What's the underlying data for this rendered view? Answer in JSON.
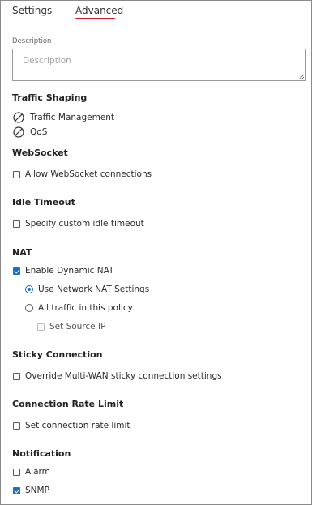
{
  "tabs": [
    {
      "label": "Settings"
    },
    {
      "label": "Advanced"
    }
  ],
  "description": {
    "label": "Description",
    "placeholder": "Description",
    "value": ""
  },
  "traffic_shaping": {
    "title": "Traffic Shaping",
    "items": [
      {
        "label": "Traffic Management",
        "icon": "ban-icon"
      },
      {
        "label": "QoS",
        "icon": "ban-icon"
      }
    ]
  },
  "websocket": {
    "title": "WebSocket",
    "allow_label": "Allow WebSocket connections",
    "allow_checked": false
  },
  "idle_timeout": {
    "title": "Idle Timeout",
    "custom_label": "Specify custom idle timeout",
    "custom_checked": false
  },
  "nat": {
    "title": "NAT",
    "enable_label": "Enable Dynamic NAT",
    "enable_checked": true,
    "options": [
      {
        "label": "Use Network NAT Settings",
        "selected": true
      },
      {
        "label": "All traffic in this policy",
        "selected": false
      }
    ],
    "source_ip_label": "Set Source IP",
    "source_ip_checked": false
  },
  "sticky": {
    "title": "Sticky Connection",
    "override_label": "Override Multi-WAN sticky connection settings",
    "override_checked": false
  },
  "rate_limit": {
    "title": "Connection Rate Limit",
    "set_label": "Set connection rate limit",
    "set_checked": false
  },
  "notification": {
    "title": "Notification",
    "alarm_label": "Alarm",
    "alarm_checked": false,
    "snmp_label": "SNMP",
    "snmp_checked": true
  },
  "colors": {
    "accent": "#d01f2f",
    "checkbox": "#1a6fc9"
  }
}
